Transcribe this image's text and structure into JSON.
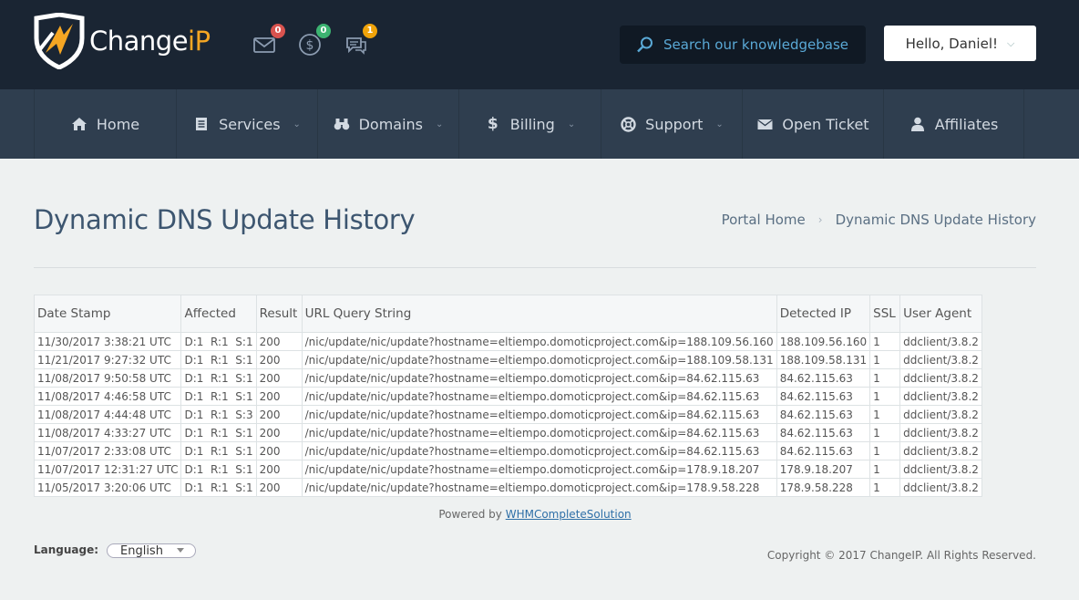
{
  "header": {
    "brand": {
      "name_main": "Change",
      "name_accent": "iP"
    },
    "icons": [
      {
        "name": "mail-icon",
        "badge": "0",
        "badge_color": "#d9534f"
      },
      {
        "name": "dollar-icon",
        "badge": "0",
        "badge_color": "#3cb371"
      },
      {
        "name": "chat-icon",
        "badge": "1",
        "badge_color": "#f0a30a"
      }
    ],
    "search_placeholder": "Search our knowledgebase",
    "user_greeting": "Hello, Daniel!"
  },
  "nav": [
    {
      "label": "Home",
      "icon": "home-icon",
      "dropdown": false
    },
    {
      "label": "Services",
      "icon": "list-icon",
      "dropdown": true
    },
    {
      "label": "Domains",
      "icon": "binoculars-icon",
      "dropdown": true
    },
    {
      "label": "Billing",
      "icon": "dollar-icon",
      "dropdown": true
    },
    {
      "label": "Support",
      "icon": "lifebuoy-icon",
      "dropdown": true
    },
    {
      "label": "Open Ticket",
      "icon": "envelope-icon",
      "dropdown": false
    },
    {
      "label": "Affiliates",
      "icon": "user-icon",
      "dropdown": false
    }
  ],
  "page": {
    "title": "Dynamic DNS Update History",
    "breadcrumb": [
      "Portal Home",
      "Dynamic DNS Update History"
    ]
  },
  "table": {
    "columns": [
      "Date Stamp",
      "Affected",
      "Result",
      "URL Query String",
      "Detected IP",
      "SSL",
      "User Agent"
    ],
    "rows": [
      [
        "11/30/2017 3:38:21 UTC",
        "D:1  R:1  S:1",
        "200",
        "/nic/update/nic/update?hostname=eltiempo.domoticproject.com&ip=188.109.56.160",
        "188.109.56.160",
        "1",
        "ddclient/3.8.2"
      ],
      [
        "11/21/2017 9:27:32 UTC",
        "D:1  R:1  S:1",
        "200",
        "/nic/update/nic/update?hostname=eltiempo.domoticproject.com&ip=188.109.58.131",
        "188.109.58.131",
        "1",
        "ddclient/3.8.2"
      ],
      [
        "11/08/2017 9:50:58 UTC",
        "D:1  R:1  S:1",
        "200",
        "/nic/update/nic/update?hostname=eltiempo.domoticproject.com&ip=84.62.115.63",
        "84.62.115.63",
        "1",
        "ddclient/3.8.2"
      ],
      [
        "11/08/2017 4:46:58 UTC",
        "D:1  R:1  S:1",
        "200",
        "/nic/update/nic/update?hostname=eltiempo.domoticproject.com&ip=84.62.115.63",
        "84.62.115.63",
        "1",
        "ddclient/3.8.2"
      ],
      [
        "11/08/2017 4:44:48 UTC",
        "D:1  R:1  S:3",
        "200",
        "/nic/update/nic/update?hostname=eltiempo.domoticproject.com&ip=84.62.115.63",
        "84.62.115.63",
        "1",
        "ddclient/3.8.2"
      ],
      [
        "11/08/2017 4:33:27 UTC",
        "D:1  R:1  S:1",
        "200",
        "/nic/update/nic/update?hostname=eltiempo.domoticproject.com&ip=84.62.115.63",
        "84.62.115.63",
        "1",
        "ddclient/3.8.2"
      ],
      [
        "11/07/2017 2:33:08 UTC",
        "D:1  R:1  S:1",
        "200",
        "/nic/update/nic/update?hostname=eltiempo.domoticproject.com&ip=84.62.115.63",
        "84.62.115.63",
        "1",
        "ddclient/3.8.2"
      ],
      [
        "11/07/2017 12:31:27 UTC",
        "D:1  R:1  S:1",
        "200",
        "/nic/update/nic/update?hostname=eltiempo.domoticproject.com&ip=178.9.18.207",
        "178.9.18.207",
        "1",
        "ddclient/3.8.2"
      ],
      [
        "11/05/2017 3:20:06 UTC",
        "D:1  R:1  S:1",
        "200",
        "/nic/update/nic/update?hostname=eltiempo.domoticproject.com&ip=178.9.58.228",
        "178.9.58.228",
        "1",
        "ddclient/3.8.2"
      ]
    ]
  },
  "footer": {
    "powered_prefix": "Powered by ",
    "powered_link": "WHMCompleteSolution",
    "language_label": "Language:",
    "language_value": "English",
    "copyright": "Copyright © 2017 ChangeIP. All Rights Reserved."
  }
}
